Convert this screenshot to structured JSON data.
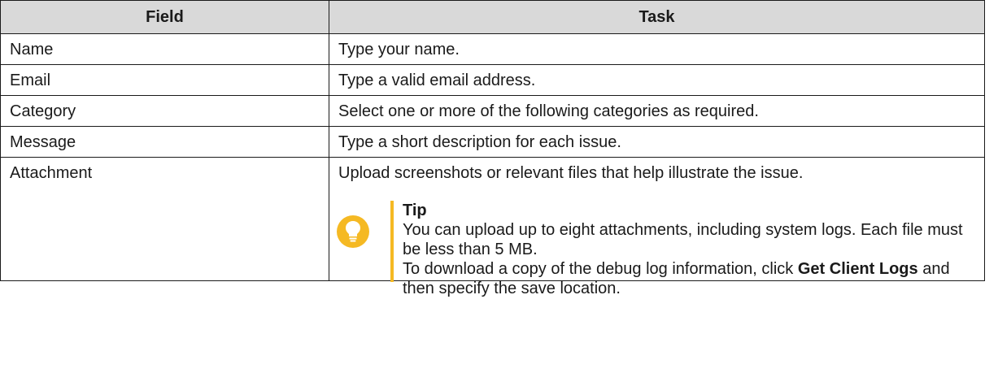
{
  "table": {
    "headers": {
      "field": "Field",
      "task": "Task"
    },
    "rows": [
      {
        "field": "Name",
        "task": "Type your name."
      },
      {
        "field": "Email",
        "task": "Type a valid email address."
      },
      {
        "field": "Category",
        "task": "Select one or more of the following categories as required."
      },
      {
        "field": "Message",
        "task": "Type a short description for each issue."
      },
      {
        "field": "Attachment",
        "task": "Upload screenshots or relevant files that help illustrate the issue."
      }
    ]
  },
  "tip": {
    "icon": "lightbulb-icon",
    "accent_color": "#f5b923",
    "title": "Tip",
    "line1": "You can upload up to eight attachments, including system logs. Each file must be less than 5 MB.",
    "line2_prefix": "To download a copy of the debug log information, click ",
    "line2_bold": "Get Client Logs",
    "line2_suffix": " and then specify the save location."
  }
}
